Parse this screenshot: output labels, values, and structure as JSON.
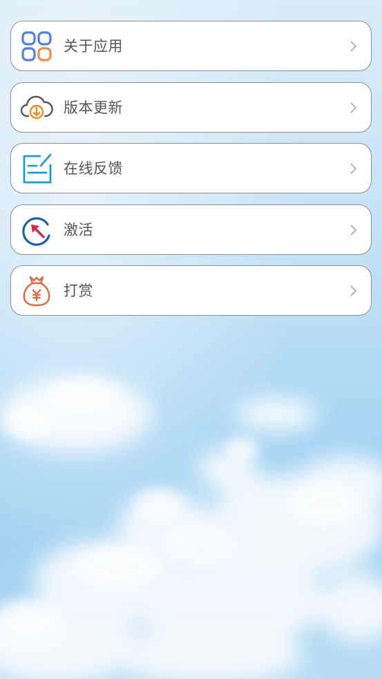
{
  "menu": {
    "items": [
      {
        "label": "关于应用",
        "icon": "apps-grid-icon",
        "color": "#4f7fe3",
        "accent": "#f08a4b"
      },
      {
        "label": "版本更新",
        "icon": "cloud-download-icon",
        "color": "#555555",
        "accent": "#f08a1a"
      },
      {
        "label": "在线反馈",
        "icon": "feedback-edit-icon",
        "color": "#1c9ad6"
      },
      {
        "label": "激活",
        "icon": "activate-cursor-icon",
        "color": "#1f5fb0",
        "accent": "#d6294b"
      },
      {
        "label": "打赏",
        "icon": "money-bag-icon",
        "color": "#e0663b"
      }
    ]
  },
  "chevron_icon": "chevron-right-icon"
}
